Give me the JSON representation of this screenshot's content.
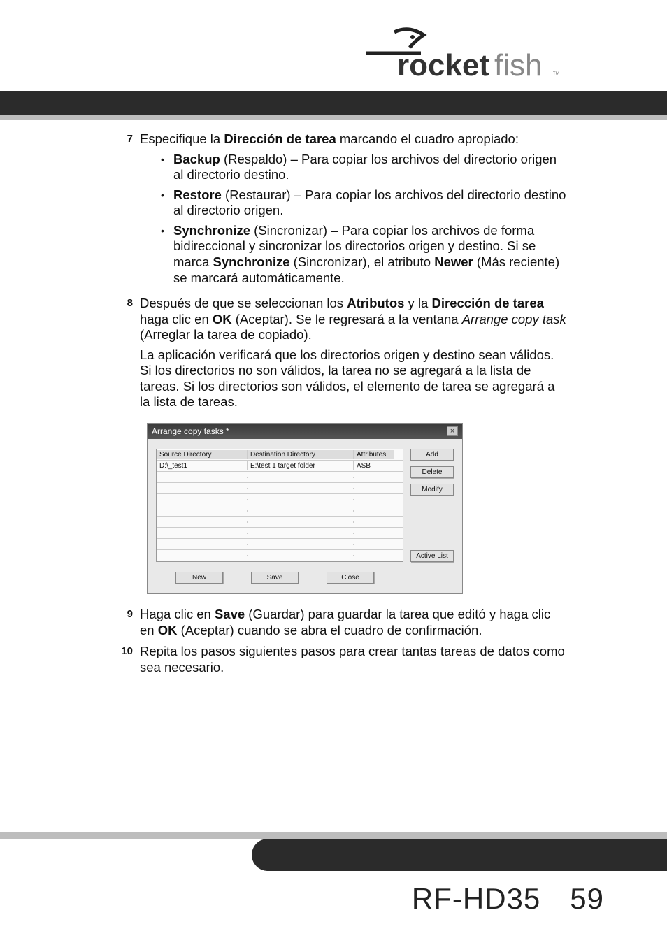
{
  "logo": {
    "brand": "rocketfish",
    "tm": "™"
  },
  "steps": {
    "s7": {
      "num": "7",
      "intro_a": "Especifique la ",
      "intro_b_bold": "Dirección de tarea",
      "intro_c": " marcando el cuadro apropiado:",
      "bullets": [
        {
          "lead_bold": "Backup",
          "rest": " (Respaldo) – Para copiar los archivos del directorio origen al directorio destino."
        },
        {
          "lead_bold": "Restore",
          "rest": " (Restaurar) – Para copiar los archivos del directorio destino al directorio origen."
        },
        {
          "lead_bold": "Synchronize",
          "rest_a": " (Sincronizar) – Para copiar los archivos de forma bidireccional y sincronizar los directorios origen y destino. Si se marca ",
          "rest_b_bold": "Synchronize",
          "rest_c": " (Sincronizar), el atributo ",
          "rest_d_bold": "Newer",
          "rest_e": " (Más reciente) se marcará automáticamente."
        }
      ]
    },
    "s8": {
      "num": "8",
      "p1_a": "Después de que se seleccionan los ",
      "p1_b_bold": "Atributos",
      "p1_c": " y la ",
      "p1_d_bold": "Dirección de tarea",
      "p1_e": " haga clic en ",
      "p1_f_bold": "OK",
      "p1_g": " (Aceptar). Se le regresará a la ventana ",
      "p1_h_ital": "Arrange copy task",
      "p1_i": " (Arreglar la tarea de copiado).",
      "p2": "La aplicación verificará que los directorios origen y destino sean válidos. Si los directorios no son válidos, la tarea no se agregará a la lista de tareas. Si los directorios son válidos, el elemento de tarea se agregará a la lista de tareas."
    },
    "s9": {
      "num": "9",
      "a": "Haga clic en ",
      "b_bold": "Save",
      "c": " (Guardar) para guardar la tarea que editó y haga clic en ",
      "d_bold": "OK",
      "e": " (Aceptar) cuando se abra el cuadro de confirmación."
    },
    "s10": {
      "num": "10",
      "text": "Repita los pasos siguientes pasos para crear tantas tareas de datos como sea necesario."
    }
  },
  "screenshot": {
    "title": "Arrange copy tasks *",
    "headers": {
      "c1": "Source Directory",
      "c2": "Destination Directory",
      "c3": "Attributes"
    },
    "row": {
      "c1": "D:\\_test1",
      "c2": "E:\\test 1 target folder",
      "c3": "ASB"
    },
    "buttons": {
      "add": "Add",
      "delete": "Delete",
      "modify": "Modify",
      "active_list": "Active List",
      "new": "New",
      "save": "Save",
      "close": "Close"
    }
  },
  "footer": {
    "model": "RF-HD35",
    "page": "59"
  }
}
